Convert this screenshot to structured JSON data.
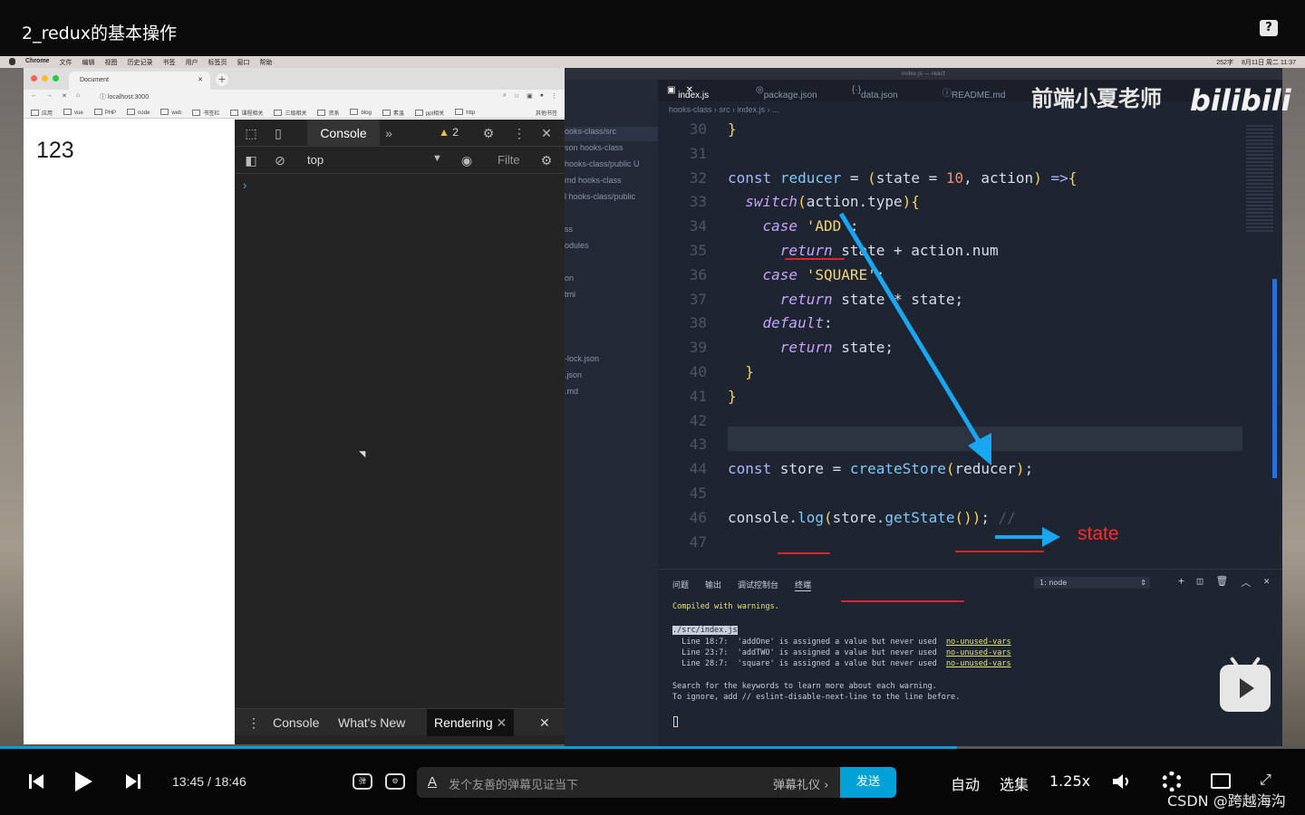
{
  "video": {
    "title": "2_redux的基本操作",
    "help_icon": "question-icon"
  },
  "menubar": {
    "items": [
      "Chrome",
      "文件",
      "编辑",
      "视图",
      "历史记录",
      "书签",
      "用户",
      "标签页",
      "窗口",
      "帮助"
    ],
    "right_status": [
      "252字",
      "8月11日 周二 11:37"
    ]
  },
  "browser": {
    "tab_title": "Document",
    "url": "localhost:3000",
    "bookmarks": [
      "应用",
      "vue",
      "PHP",
      "node",
      "web",
      "书签栏",
      "课程相关",
      "三级相关",
      "资系",
      "blog",
      "素温",
      "ppt相关",
      "http"
    ],
    "other_bookmarks": "其他书签",
    "page_text": "123"
  },
  "devtools": {
    "console_tab": "Console",
    "warnings_count": "2",
    "context": "top",
    "filter_placeholder": "Filte",
    "prompt": "›",
    "drawer_tabs": [
      "Console",
      "What's New",
      "Rendering"
    ]
  },
  "vscode": {
    "window_title": "index.js — react",
    "tabs": [
      "index.js",
      "package.json",
      "data.json",
      "README.md"
    ],
    "breadcrumb": "hooks-class › src › index.js › ...",
    "explorer_items": [
      {
        "text": "ooks-class/src",
        "y": 0
      },
      {
        "text": "son  hooks-class"
      },
      {
        "text": "hooks-class/public  U"
      },
      {
        "text": "md  hooks-class"
      },
      {
        "text": "l  hooks-class/public"
      },
      {
        "text": "ss"
      },
      {
        "text": "odules"
      },
      {
        "text": "on"
      },
      {
        "text": "tml"
      },
      {
        "text": "-lock.json"
      },
      {
        "text": ".json"
      },
      {
        "text": ".md"
      }
    ],
    "watermark": "前端小夏老师",
    "logo": "bilibili",
    "code_lines": [
      {
        "n": "30",
        "html": "<span class='br'>}</span>"
      },
      {
        "n": "31",
        "html": ""
      },
      {
        "n": "32",
        "html": "<span class='kw'>const</span> <span class='fn'>reducer</span> = <span class='br'>(</span>state = <span class='num'>10</span>, action<span class='br'>)</span> <span class='kw'>=&gt;</span><span class='br'>{</span>"
      },
      {
        "n": "33",
        "html": "  <span class='it'>switch</span><span class='br'>(</span>action.type<span class='br'>){</span>"
      },
      {
        "n": "34",
        "html": "    <span class='it'>case</span> <span class='str'>'ADD'</span>:"
      },
      {
        "n": "35",
        "html": "      <span class='it'>return</span> state + action.num"
      },
      {
        "n": "36",
        "html": "    <span class='it'>case</span> <span class='str'>'SQUARE'</span>:"
      },
      {
        "n": "37",
        "html": "      <span class='it'>return</span> state * state;"
      },
      {
        "n": "38",
        "html": "    <span class='it'>default</span>:"
      },
      {
        "n": "39",
        "html": "      <span class='it'>return</span> state;"
      },
      {
        "n": "40",
        "html": "  <span class='br'>}</span>"
      },
      {
        "n": "41",
        "html": "<span class='br'>}</span>"
      },
      {
        "n": "42",
        "html": ""
      },
      {
        "n": "43",
        "html": ""
      },
      {
        "n": "44",
        "html": "<span class='kw'>const</span> store = <span class='fn'>createStore</span><span class='br'>(</span>reducer<span class='br'>)</span>;"
      },
      {
        "n": "45",
        "html": ""
      },
      {
        "n": "46",
        "html": "console.<span class='fn'>log</span><span class='br'>(</span>store.<span class='fn'>getState</span><span class='br'>()</span><span class='br'>)</span>; <span style='color:#4d5566'>//</span>"
      },
      {
        "n": "47",
        "html": ""
      }
    ],
    "annotation_label": "state",
    "terminal": {
      "tabs": [
        "问题",
        "输出",
        "调试控制台",
        "终端"
      ],
      "selector": "1: node",
      "lines": [
        {
          "text": "Compiled with warnings.",
          "cls": "y"
        },
        {
          "text": ""
        },
        {
          "text": "./src/index.js",
          "cls": "path"
        },
        {
          "text": "  Line 18:7:  'addOne' is assigned a value but never used  ",
          "link": "no-unused-vars"
        },
        {
          "text": "  Line 23:7:  'addTWO' is assigned a value but never used  ",
          "link": "no-unused-vars"
        },
        {
          "text": "  Line 28:7:  'square' is assigned a value but never used  ",
          "link": "no-unused-vars"
        },
        {
          "text": ""
        },
        {
          "text": "Search for the keywords to learn more about each warning."
        },
        {
          "text": "To ignore, add // eslint-disable-next-line to the line before."
        }
      ]
    }
  },
  "player": {
    "current_time": "13:45",
    "separator": "/",
    "duration": "18:46",
    "progress": 0.733,
    "danmaku_placeholder": "发个友善的弹幕见证当下",
    "danmaku_etiquette": "弹幕礼仪 ›",
    "send_label": "发送",
    "auto_label": "自动",
    "episodes_label": "选集",
    "speed_label": "1.25x",
    "credit": "CSDN @跨越海沟",
    "accent_color": "#00a1d6"
  }
}
